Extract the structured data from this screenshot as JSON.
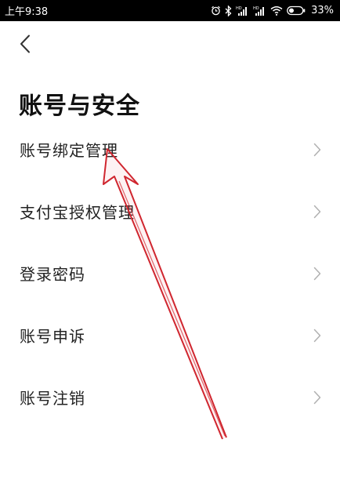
{
  "status_bar": {
    "time": "上午9:38",
    "battery": "33%"
  },
  "header": {
    "back_icon": "chevron-left-icon",
    "title": "账号与安全"
  },
  "menu": {
    "items": [
      {
        "label": "账号绑定管理",
        "icon": "chevron-right-icon"
      },
      {
        "label": "支付宝授权管理",
        "icon": "chevron-right-icon"
      },
      {
        "label": "登录密码",
        "icon": "chevron-right-icon"
      },
      {
        "label": "账号申诉",
        "icon": "chevron-right-icon"
      },
      {
        "label": "账号注销",
        "icon": "chevron-right-icon"
      }
    ]
  },
  "annotation": {
    "type": "red-arrow",
    "color": "#d0262f",
    "points_to": "账号绑定管理"
  },
  "colors": {
    "status_bar_bg": "#000000",
    "page_bg": "#ffffff",
    "text": "#222222",
    "chevron": "#b0b0b0"
  }
}
